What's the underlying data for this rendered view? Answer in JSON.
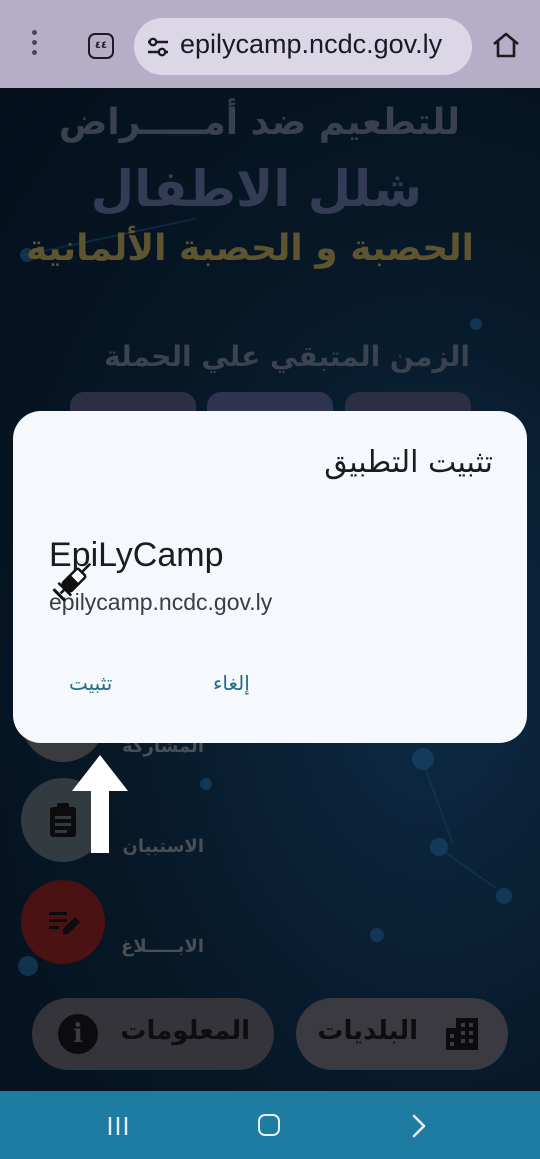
{
  "browser": {
    "url": "epilycamp.ncdc.gov.ly",
    "tab_count": "٤٤"
  },
  "page": {
    "headline_line1": "للتطعيم ضد أمـــــراض",
    "headline_line2": "شلل الاطفال",
    "headline_line3": "الحصبة و الحصبة الألمانية",
    "remaining_time": "الزمن المتبقي علي الحملة",
    "actions": {
      "participation_label": "المشاركة",
      "survey_label": "الاستبيان",
      "report_label": "الابـــــلاغ"
    },
    "bottom_buttons": {
      "info_label": "المعلومات",
      "municipalities_label": "البلديات"
    }
  },
  "dialog": {
    "title": "تثبيت التطبيق",
    "app_name": "EpiLyCamp",
    "app_url": "epilycamp.ncdc.gov.ly",
    "install_label": "تثبيت",
    "cancel_label": "إلغاء"
  },
  "colors": {
    "dialog_bg": "#f5f8fd",
    "accent": "#1f6f8b",
    "topbar": "#b5aec6",
    "navbar": "#1e7ba1"
  },
  "icons": {
    "menu": "more-vert-icon",
    "tabs": "tab-switcher-icon",
    "site_settings": "tune-icon",
    "home": "home-icon",
    "app": "syringe-icon",
    "info": "info-icon",
    "municipalities": "building-icon",
    "survey": "clipboard-icon",
    "report": "edit-note-icon",
    "overlay": "arrow-up-icon"
  }
}
